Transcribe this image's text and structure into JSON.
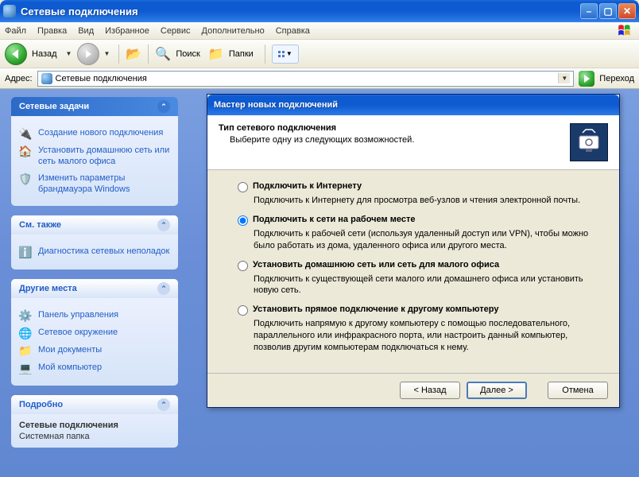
{
  "window": {
    "title": "Сетевые подключения"
  },
  "menu": {
    "file": "Файл",
    "edit": "Правка",
    "view": "Вид",
    "favorites": "Избранное",
    "tools": "Сервис",
    "advanced": "Дополнительно",
    "help": "Справка"
  },
  "toolbar": {
    "back": "Назад",
    "search": "Поиск",
    "folders": "Папки"
  },
  "address": {
    "label": "Адрес:",
    "value": "Сетевые подключения",
    "go": "Переход"
  },
  "sidebar": {
    "tasks": {
      "title": "Сетевые задачи",
      "items": [
        {
          "label": "Создание нового подключения",
          "icon": "🔌"
        },
        {
          "label": "Установить домашнюю сеть или сеть малого офиса",
          "icon": "🏠"
        },
        {
          "label": "Изменить параметры брандмауэра Windows",
          "icon": "🛡️"
        }
      ]
    },
    "seealso": {
      "title": "См. также",
      "items": [
        {
          "label": "Диагностика сетевых неполадок",
          "icon": "ℹ️"
        }
      ]
    },
    "places": {
      "title": "Другие места",
      "items": [
        {
          "label": "Панель управления",
          "icon": "⚙️"
        },
        {
          "label": "Сетевое окружение",
          "icon": "🌐"
        },
        {
          "label": "Мои документы",
          "icon": "📁"
        },
        {
          "label": "Мой компьютер",
          "icon": "💻"
        }
      ]
    },
    "details": {
      "title": "Подробно",
      "name": "Сетевые подключения",
      "type": "Системная папка"
    }
  },
  "wizard": {
    "title": "Мастер новых подключений",
    "header_title": "Тип сетевого подключения",
    "header_sub": "Выберите одну из следующих возможностей.",
    "options": [
      {
        "label": "Подключить к Интернету",
        "desc": "Подключить к Интернету для просмотра веб-узлов и чтения электронной почты."
      },
      {
        "label": "Подключить к сети на рабочем месте",
        "desc": "Подключить к рабочей сети (используя удаленный доступ или VPN), чтобы можно было работать из дома, удаленного офиса или другого места."
      },
      {
        "label": "Установить домашнюю сеть или сеть для малого офиса",
        "desc": "Подключить к существующей сети малого или домашнего офиса или установить новую сеть."
      },
      {
        "label": "Установить прямое подключение к другому компьютеру",
        "desc": "Подключить напрямую к другому компьютеру с помощью последовательного, параллельного или инфракрасного порта, или настроить данный компьютер, позволив другим компьютерам подключаться к нему."
      }
    ],
    "selected": 1,
    "buttons": {
      "back": "< Назад",
      "next": "Далее >",
      "cancel": "Отмена"
    }
  }
}
